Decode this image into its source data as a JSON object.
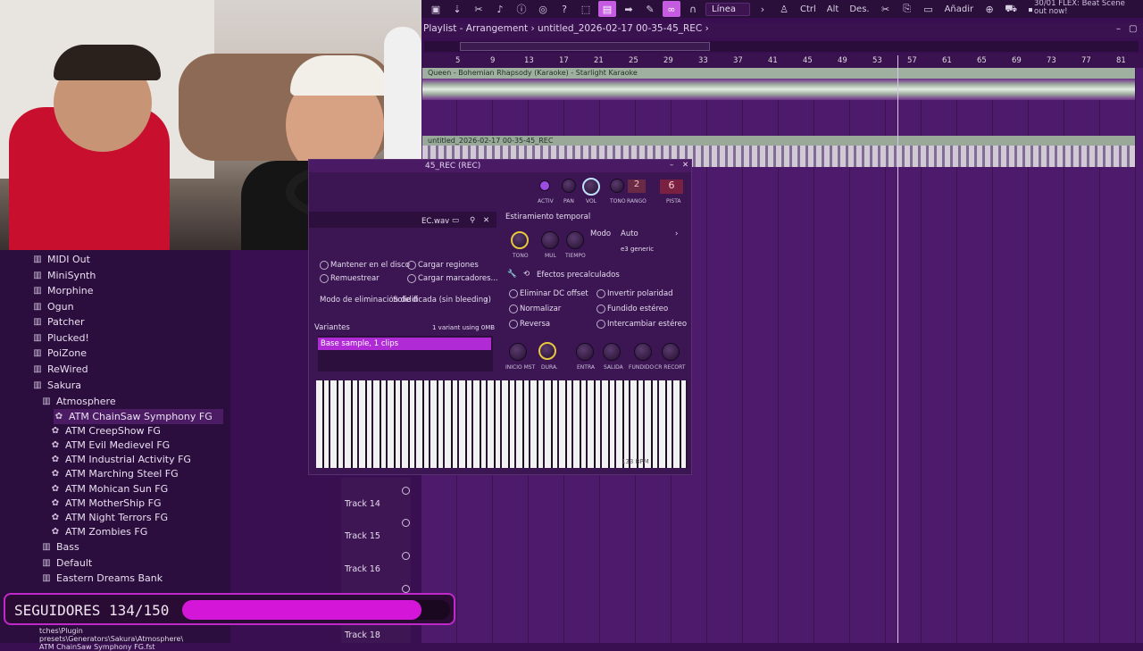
{
  "toolbar": {
    "line_select": "Línea",
    "ctrl": "Ctrl",
    "alt": "Alt",
    "des": "Des.",
    "add": "Añadir"
  },
  "news": {
    "date": "30/01",
    "text": "FLEX: Beat Scene",
    "text2": "out now!"
  },
  "playlist": {
    "title": "Playlist - Arrangement",
    "project": "untitled_2026-02-17 00-35-45_REC",
    "ruler": [
      "5",
      "9",
      "13",
      "17",
      "21",
      "25",
      "29",
      "33",
      "37",
      "41",
      "45",
      "49",
      "53",
      "57",
      "61",
      "65",
      "69",
      "73",
      "77",
      "81"
    ],
    "clip1_label": "Queen - Bohemian Rhapsody (Karaoke) - Starlight Karaoke",
    "clip2_label": "untitled_2026-02-17 00-35-45_REC"
  },
  "browser": {
    "items": [
      {
        "label": "MIDI Out"
      },
      {
        "label": "MiniSynth"
      },
      {
        "label": "Morphine"
      },
      {
        "label": "Ogun"
      },
      {
        "label": "Patcher"
      },
      {
        "label": "Plucked!"
      },
      {
        "label": "PoiZone"
      },
      {
        "label": "ReWired"
      },
      {
        "label": "Sakura"
      },
      {
        "label": "Atmosphere"
      },
      {
        "label": "ATM ChainSaw Symphony FG"
      },
      {
        "label": "ATM CreepShow FG"
      },
      {
        "label": "ATM Evil Medievel FG"
      },
      {
        "label": "ATM Industrial Activity FG"
      },
      {
        "label": "ATM Marching Steel FG"
      },
      {
        "label": "ATM Mohican Sun FG"
      },
      {
        "label": "ATM MotherShip FG"
      },
      {
        "label": "ATM Night Terrors FG"
      },
      {
        "label": "ATM Zombies FG"
      },
      {
        "label": "Bass"
      },
      {
        "label": "Default"
      },
      {
        "label": "Eastern Dreams Bank"
      }
    ]
  },
  "tracks": [
    "Track 14",
    "Track 15",
    "Track 16",
    "Track 18"
  ],
  "sampler": {
    "title": "45_REC (REC)",
    "file_tab": "EC.wav",
    "activ": "ACTIV",
    "pan": "PAN",
    "vol": "VOL",
    "tono": "TONO",
    "rango": "RANGO",
    "pista": "PISTA",
    "rango_val": "2",
    "pista_val": "6",
    "time_stretch": "Estiramiento temporal",
    "mode_label": "Modo",
    "mode_value": "Auto",
    "e3_generic": "e3 generic",
    "k_tono": "TONO",
    "k_mul": "MUL",
    "k_tiempo": "TIEMPO",
    "keep_on_disk": "Mantener en el disco",
    "load_regions": "Cargar regiones",
    "resample": "Remuestrear",
    "load_markers": "Cargar marcadores...",
    "removal_mode": "Modo de eliminación de datos",
    "removal_value": "Solidificada (sin bleeding)",
    "precalc": "Efectos precalculados",
    "dc_offset": "Eliminar DC offset",
    "invert": "Invertir polaridad",
    "normalize": "Normalizar",
    "stereo_fade": "Fundido estéreo",
    "reverse": "Reversa",
    "swap_stereo": "Intercambiar estéreo",
    "k_inicio": "INICIO MST",
    "k_dura": "DURA.",
    "k_entra": "ENTRA",
    "k_salida": "SALIDA",
    "k_fundido": "FUNDIDO",
    "k_cr": "CR RECORT",
    "variants": "Variantes",
    "variant_info": "1 variant using 0MB",
    "variant_item": "Base sample, 1 clips",
    "bpm": "133 BPM"
  },
  "follow": {
    "label": "SEGUIDORES 134/150",
    "current": 134,
    "target": 150
  },
  "path": {
    "line1": "tches\\Plugin presets\\Generators\\Sakura\\Atmosphere\\",
    "line2": "ATM ChainSaw Symphony FG.fst"
  }
}
